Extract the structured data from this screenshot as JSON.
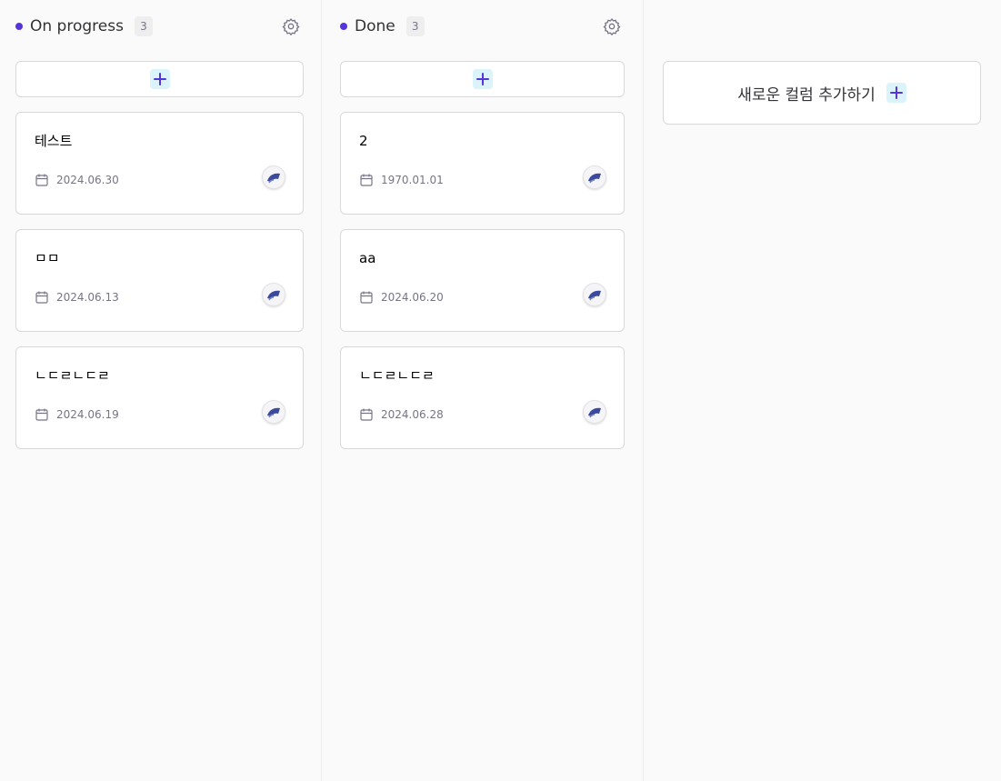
{
  "columns": [
    {
      "title": "On progress",
      "count": "3",
      "cards": [
        {
          "title": "테스트",
          "date": "2024.06.30"
        },
        {
          "title": "ㅁㅁ",
          "date": "2024.06.13"
        },
        {
          "title": "ㄴㄷㄹㄴㄷㄹ",
          "date": "2024.06.19"
        }
      ]
    },
    {
      "title": "Done",
      "count": "3",
      "cards": [
        {
          "title": "2",
          "date": "1970.01.01"
        },
        {
          "title": "aa",
          "date": "2024.06.20"
        },
        {
          "title": "ㄴㄷㄹㄴㄷㄹ",
          "date": "2024.06.28"
        }
      ]
    }
  ],
  "add_column": {
    "label": "새로운 컬럼 추가하기"
  },
  "colors": {
    "accent": "#5534da",
    "plus_chip_bg": "#dbf3fb",
    "plus_icon": "#5534da",
    "border": "#d9d9d9",
    "background": "#fafafa"
  },
  "icons": {
    "status_dot": "status-dot-icon",
    "settings": "gear-icon",
    "add": "plus-icon",
    "due_date": "calendar-icon",
    "assignee": "avatar"
  }
}
